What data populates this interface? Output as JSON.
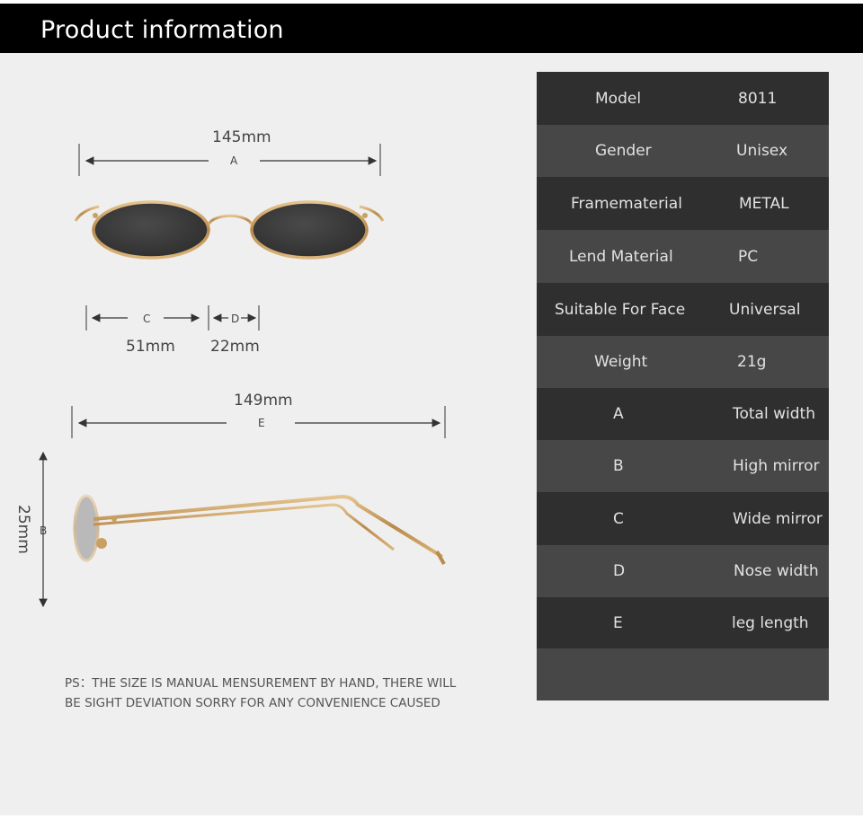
{
  "header": {
    "title": "Product information"
  },
  "dimensions": {
    "a_value": "145mm",
    "a_letter": "A",
    "c_value": "51mm",
    "c_letter": "C",
    "d_value": "22mm",
    "d_letter": "D",
    "e_value": "149mm",
    "e_letter": "E",
    "b_value": "25mm",
    "b_letter": "B"
  },
  "note": {
    "line1": "PS：THE SIZE IS MANUAL MENSUREMENT BY HAND, THERE WILL",
    "line2": "BE SIGHT DEVIATION SORRY FOR ANY CONVENIENCE CAUSED"
  },
  "specs": [
    {
      "key": "Model",
      "value": "8011"
    },
    {
      "key": "Gender",
      "value": "Unisex"
    },
    {
      "key": "Framematerial",
      "value": "METAL"
    },
    {
      "key": "Lend Material",
      "value": "PC"
    },
    {
      "key": "Suitable For Face",
      "value": "Universal"
    },
    {
      "key": "Weight",
      "value": "21g"
    },
    {
      "key": "A",
      "value": "Total width"
    },
    {
      "key": "B",
      "value": "High mirror"
    },
    {
      "key": "C",
      "value": "Wide mirror"
    },
    {
      "key": "D",
      "value": "Nose width"
    },
    {
      "key": "E",
      "value": "leg length"
    },
    {
      "key": "",
      "value": ""
    }
  ],
  "colors": {
    "frame_gold": "#c9a063",
    "lens_dark": "#3a3a3a",
    "table_dark": "#2f2f2f",
    "table_light": "#474747"
  }
}
